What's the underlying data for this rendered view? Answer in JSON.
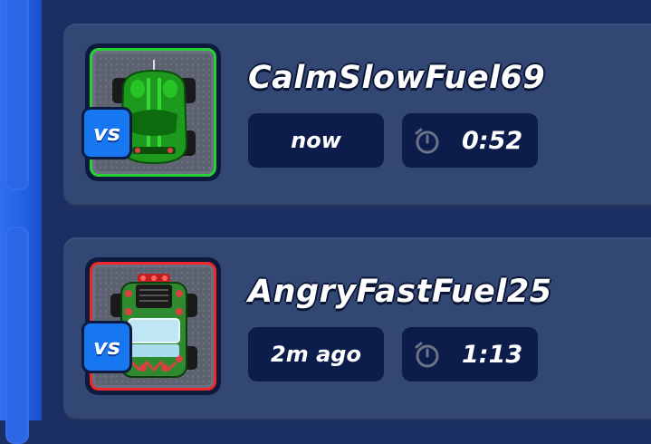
{
  "matches": [
    {
      "vs_label": "vs",
      "player": "CalmSlowFuel69",
      "time_ago": "now",
      "duration": "0:52",
      "result_color": "#28d038",
      "car_icon": "green-car-icon"
    },
    {
      "vs_label": "vs",
      "player": "AngryFastFuel25",
      "time_ago": "2m ago",
      "duration": "1:13",
      "result_color": "#f02828",
      "car_icon": "patterned-jeep-icon"
    }
  ]
}
